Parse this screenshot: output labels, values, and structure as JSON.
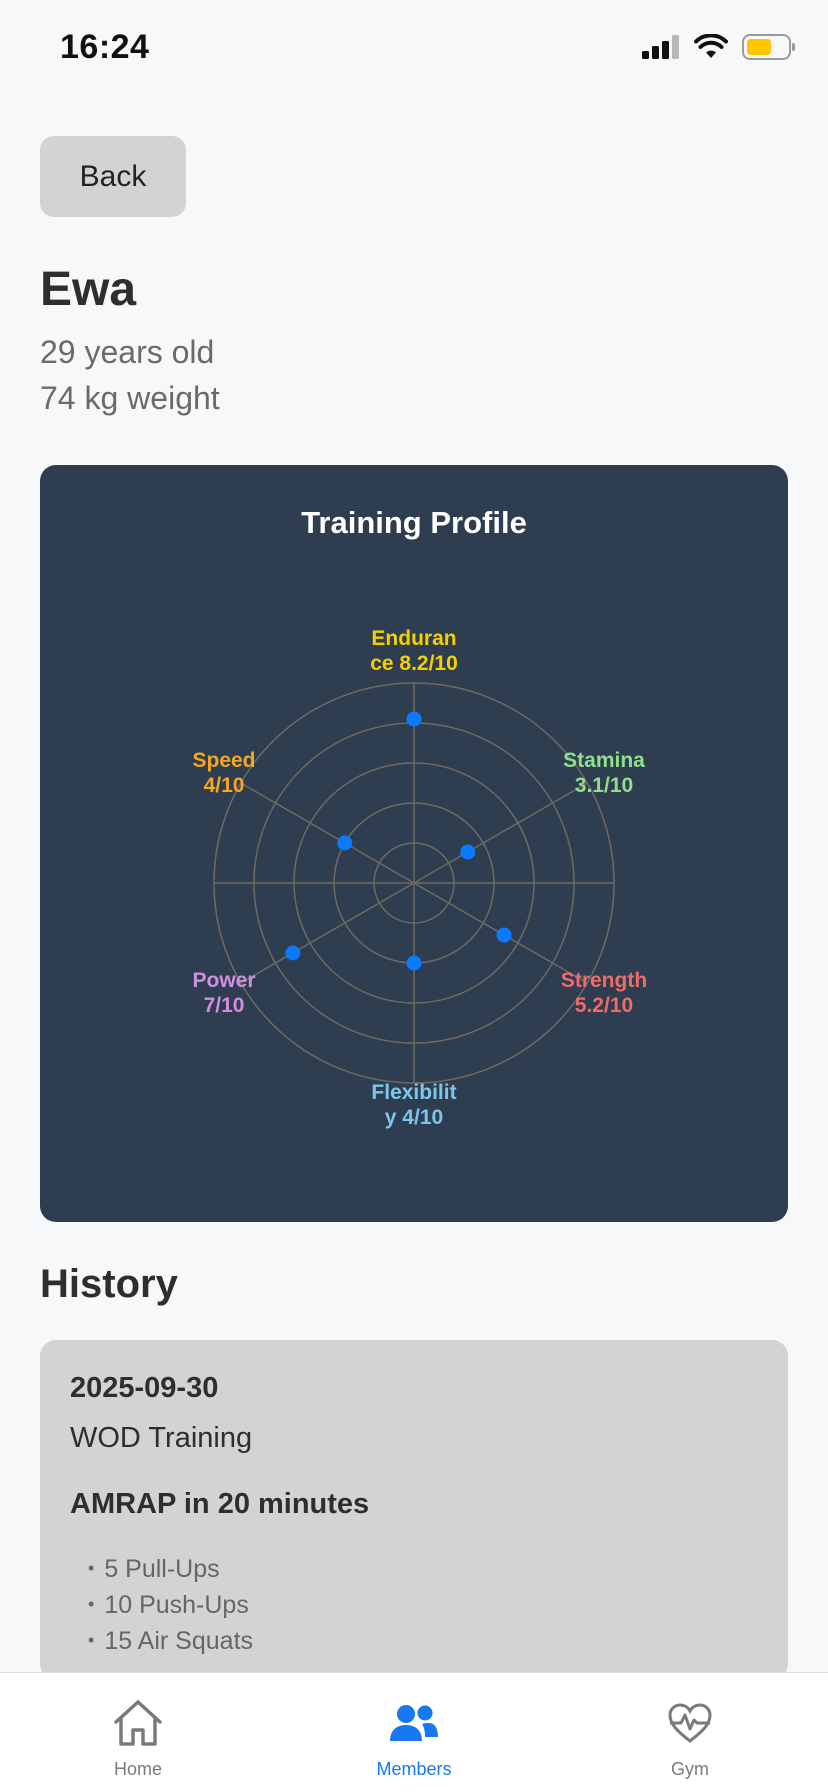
{
  "status_bar": {
    "time": "16:24"
  },
  "header": {
    "back_label": "Back"
  },
  "member": {
    "name": "Ewa",
    "age": "29 years old",
    "weight": "74 kg weight"
  },
  "training_profile": {
    "title": "Training Profile",
    "axes": [
      {
        "name": "Endurance",
        "value": 8.2,
        "line1": "Enduran",
        "line2": "ce 8.2/10",
        "color": "#f5d000"
      },
      {
        "name": "Stamina",
        "value": 3.1,
        "line1": "Stamina",
        "line2": "3.1/10",
        "color": "#8fe08a"
      },
      {
        "name": "Strength",
        "value": 5.2,
        "line1": "Strength",
        "line2": "5.2/10",
        "color": "#f06a6a"
      },
      {
        "name": "Flexibility",
        "value": 4,
        "line1": "Flexibilit",
        "line2": "y 4/10",
        "color": "#7cc6ec"
      },
      {
        "name": "Power",
        "value": 7,
        "line1": "Power",
        "line2": "7/10",
        "color": "#d08ee0"
      },
      {
        "name": "Speed",
        "value": 4,
        "line1": "Speed",
        "line2": "4/10",
        "color": "#f5a623"
      }
    ],
    "max": 10,
    "point_color": "#0a7aff",
    "grid_color": "#6e6a62"
  },
  "history": {
    "title": "History",
    "entries": [
      {
        "date": "2025-09-30",
        "type": "WOD Training",
        "workout": "AMRAP in 20 minutes",
        "exercises": [
          "5 Pull-Ups",
          "10 Push-Ups",
          "15 Air Squats"
        ]
      }
    ]
  },
  "tab_bar": {
    "items": [
      {
        "label": "Home",
        "icon": "home-icon",
        "active": false
      },
      {
        "label": "Members",
        "icon": "members-icon",
        "active": true
      },
      {
        "label": "Gym",
        "icon": "heart-pulse-icon",
        "active": false
      }
    ],
    "active_color": "#1877f2",
    "inactive_color": "#7a7a7a"
  }
}
